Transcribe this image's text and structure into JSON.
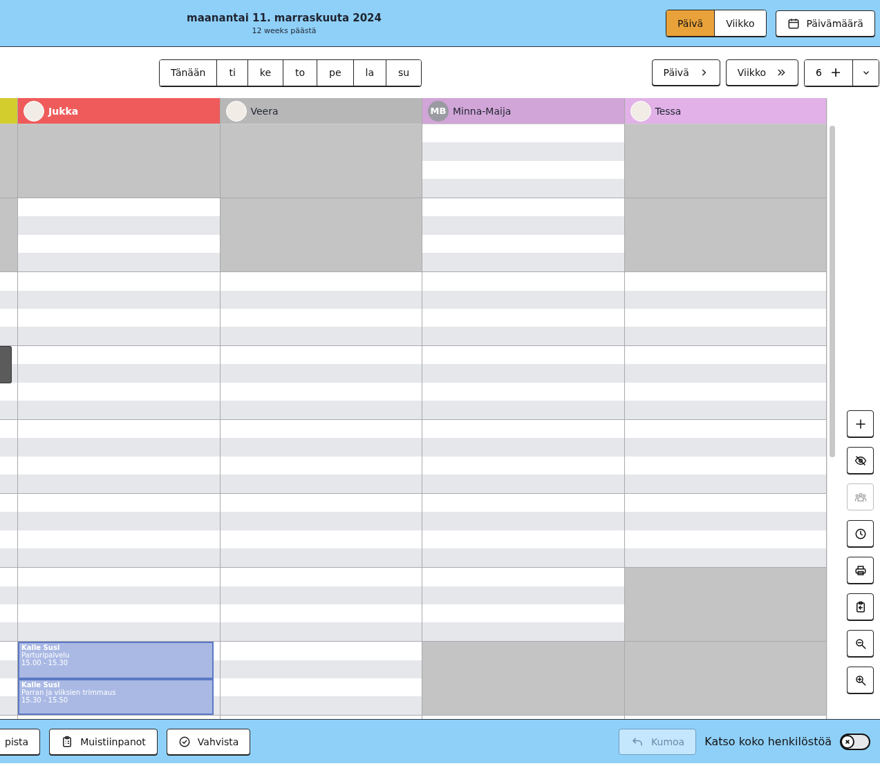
{
  "header": {
    "title": "maanantai 11. marraskuuta 2024",
    "subtitle": "12 weeks päästä",
    "view_tabs": [
      {
        "label": "Päivä",
        "selected": true
      },
      {
        "label": "Viikko",
        "selected": false
      }
    ],
    "date_button": "Päivämäärä"
  },
  "day_nav": [
    "Tänään",
    "ti",
    "ke",
    "to",
    "pe",
    "la",
    "su"
  ],
  "step_buttons": [
    {
      "label": "Päivä",
      "kind": "single"
    },
    {
      "label": "Viikko",
      "kind": "double"
    }
  ],
  "count_button": "6",
  "partial_column": {
    "color": "#d4cd2e",
    "hours": [
      {
        "available": false,
        "blocked": false
      },
      {
        "available": false,
        "blocked": false
      },
      {
        "available": true,
        "blocked": false
      },
      {
        "available": true,
        "blocked": true
      },
      {
        "available": true,
        "blocked": false
      },
      {
        "available": true,
        "blocked": false
      },
      {
        "available": true,
        "blocked": false
      },
      {
        "available": true,
        "blocked": false
      }
    ]
  },
  "columns": [
    {
      "name": "Jukka",
      "color": "#ef5b5b",
      "light_text": true,
      "avatar": {
        "kind": "photo"
      },
      "hours": [
        {
          "available": false
        },
        {
          "available": true
        },
        {
          "available": true
        },
        {
          "available": true
        },
        {
          "available": true
        },
        {
          "available": true
        },
        {
          "available": true
        },
        {
          "available": true,
          "events": [
            {
              "customer": "Kalle Susi",
              "service": "Parturipalvelu",
              "time": "15.00 - 15.30"
            },
            {
              "customer": "Kalle Susi",
              "service": "Parran ja viiksien trimmaus",
              "time": "15.30 - 15.50"
            }
          ]
        }
      ]
    },
    {
      "name": "Veera",
      "color": "#b7b7b7",
      "light_text": false,
      "avatar": {
        "kind": "photo"
      },
      "hours": [
        {
          "available": false
        },
        {
          "available": false
        },
        {
          "available": true
        },
        {
          "available": true
        },
        {
          "available": true
        },
        {
          "available": true
        },
        {
          "available": true
        },
        {
          "available": true
        }
      ]
    },
    {
      "name": "Minna-Maija",
      "color": "#d1a5d7",
      "light_text": false,
      "avatar": {
        "kind": "initials",
        "text": "MB"
      },
      "hours": [
        {
          "available": true
        },
        {
          "available": true
        },
        {
          "available": true
        },
        {
          "available": true
        },
        {
          "available": true
        },
        {
          "available": true
        },
        {
          "available": true
        },
        {
          "available": false
        }
      ]
    },
    {
      "name": "Tessa",
      "color": "#e1b1e7",
      "light_text": false,
      "avatar": {
        "kind": "photo"
      },
      "hours": [
        {
          "available": false
        },
        {
          "available": false
        },
        {
          "available": true
        },
        {
          "available": true
        },
        {
          "available": true
        },
        {
          "available": true
        },
        {
          "available": false
        },
        {
          "available": false
        }
      ]
    }
  ],
  "side_tools": [
    {
      "kind": "add",
      "disabled": false
    },
    {
      "kind": "hide",
      "disabled": false
    },
    {
      "kind": "staff",
      "disabled": true
    },
    {
      "kind": "clock",
      "disabled": false
    },
    {
      "kind": "print",
      "disabled": false
    },
    {
      "kind": "paste",
      "disabled": false
    },
    {
      "kind": "zoom-out",
      "disabled": false
    },
    {
      "kind": "zoom-in",
      "disabled": false
    }
  ],
  "footer": {
    "buttons": [
      {
        "label": "pista",
        "kind": "plain"
      },
      {
        "label": "Muistiinpanot",
        "kind": "notes"
      },
      {
        "label": "Vahvista",
        "kind": "confirm"
      }
    ],
    "undo": {
      "label": "Kumoa",
      "disabled": true
    },
    "toggle": {
      "label": "Katso koko henkilöstöä",
      "on": false
    }
  }
}
